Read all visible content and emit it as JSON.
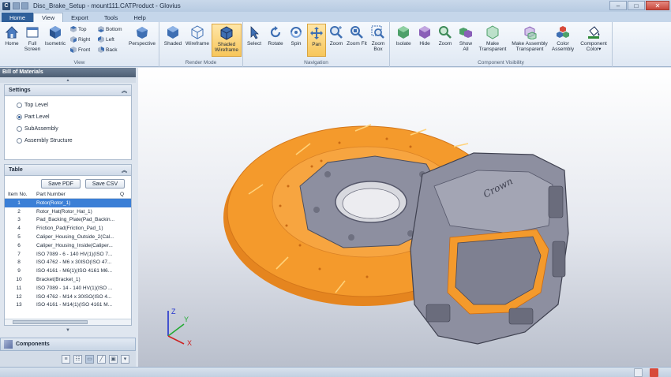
{
  "window": {
    "app_icon_letter": "C",
    "title": "Disc_Brake_Setup - mount111.CATProduct - Glovius",
    "minimize": "–",
    "maximize": "□",
    "close": "✕"
  },
  "menu": {
    "tabs": [
      "Home",
      "View",
      "Export",
      "Tools",
      "Help"
    ]
  },
  "ribbon": {
    "view": {
      "label": "View",
      "home": "Home",
      "fullscreen": "Full Screen",
      "isometric": "Isometric",
      "top": "Top",
      "right": "Right",
      "front": "Front",
      "bottom": "Bottom",
      "left": "Left",
      "back": "Back",
      "perspective": "Perspective"
    },
    "render": {
      "label": "Render Mode",
      "shaded": "Shaded",
      "wireframe": "Wireframe",
      "shaded_wireframe": "Shaded Wireframe"
    },
    "navigation": {
      "label": "Navigation",
      "select": "Select",
      "rotate": "Rotate",
      "spin": "Spin",
      "pan": "Pan",
      "zoom": "Zoom",
      "zoom_fit": "Zoom Fit",
      "zoom_box": "Zoom Box"
    },
    "visibility": {
      "label": "Component Visibility",
      "isolate": "Isolate",
      "hide": "Hide",
      "zoom": "Zoom",
      "show_all": "Show All",
      "make_transparent": "Make Transparent",
      "make_assembly_transparent": "Make Assembly Transparent",
      "color_assembly": "Color Assembly",
      "component_color": "Component Color▾"
    }
  },
  "left_panel": {
    "title": "Bill of Materials",
    "settings": {
      "title": "Settings",
      "options": [
        "Top Level",
        "Part Level",
        "SubAssembly",
        "Assembly Structure"
      ],
      "selected": "Part Level"
    },
    "table": {
      "title": "Table",
      "save_pdf": "Save PDF",
      "save_csv": "Save CSV",
      "columns": [
        "Item No.",
        "Part Number",
        "Q"
      ],
      "rows": [
        {
          "no": "1",
          "part": "Rotor(Rotor_1)"
        },
        {
          "no": "2",
          "part": "Rotor_Hat(Rotor_Hat_1)"
        },
        {
          "no": "3",
          "part": "Pad_Backing_Plate(Pad_Backin..."
        },
        {
          "no": "4",
          "part": "Friction_Pad(Friction_Pad_1)"
        },
        {
          "no": "5",
          "part": "Caliper_Housing_Outside_2(Cal..."
        },
        {
          "no": "6",
          "part": "Caliper_Housing_Inside(Caliper..."
        },
        {
          "no": "7",
          "part": "ISO 7089 - 6 - 140 HV(1)(ISO 7..."
        },
        {
          "no": "8",
          "part": "ISO 4762 - M6 x 30ISO(ISO 47..."
        },
        {
          "no": "9",
          "part": "ISO 4161 - M6(1)(ISO 4161 M6..."
        },
        {
          "no": "10",
          "part": "Bracket(Bracket_1)"
        },
        {
          "no": "11",
          "part": "ISO 7089 - 14 - 140 HV(1)(ISO ..."
        },
        {
          "no": "12",
          "part": "ISO 4762 - M14 x 30ISO(ISO 4..."
        },
        {
          "no": "13",
          "part": "ISO 4161 - M14(1)(ISO 4161 M..."
        }
      ],
      "selected_index": 0
    },
    "components_label": "Components"
  },
  "viewport": {
    "caliper_brand": "Crown",
    "axes": {
      "x": "X",
      "y": "Y",
      "z": "Z"
    }
  },
  "colors": {
    "rotor": "#f49a2c",
    "caliper": "#8d8fa0",
    "selection": "#3b7fd6",
    "accent": "#2f5f9a"
  }
}
